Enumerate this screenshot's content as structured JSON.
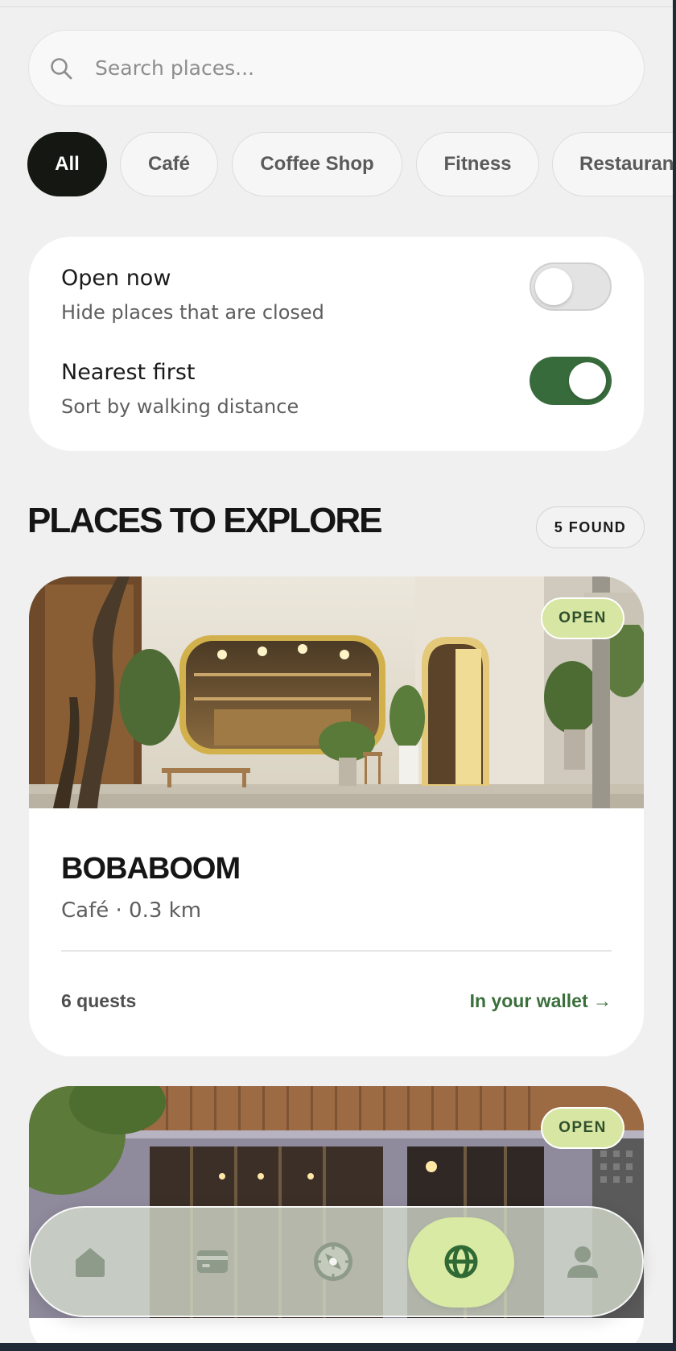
{
  "search": {
    "placeholder": "Search places..."
  },
  "filters": {
    "chips": [
      "All",
      "Café",
      "Coffee Shop",
      "Fitness",
      "Restaurant"
    ],
    "selected": "All"
  },
  "toggles": {
    "open_now": {
      "title": "Open now",
      "subtitle": "Hide places that are closed",
      "on": false
    },
    "nearest_first": {
      "title": "Nearest first",
      "subtitle": "Sort by walking distance",
      "on": true
    }
  },
  "section": {
    "title": "PLACES TO EXPLORE",
    "count_label": "5 FOUND"
  },
  "places": [
    {
      "status": "OPEN",
      "name": "BOBABOOM",
      "meta": "Café · 0.3 km",
      "quests": "6 quests",
      "action": "In your wallet →"
    },
    {
      "status": "OPEN"
    }
  ],
  "nav": {
    "items": [
      "home-icon",
      "wallet-icon",
      "compass-icon",
      "globe-icon",
      "profile-icon"
    ],
    "active": "globe-icon"
  },
  "colors": {
    "accent": "#386b3c",
    "badge": "#d7e6a2",
    "chip_active": "#151712",
    "background": "#f0f0f0"
  }
}
